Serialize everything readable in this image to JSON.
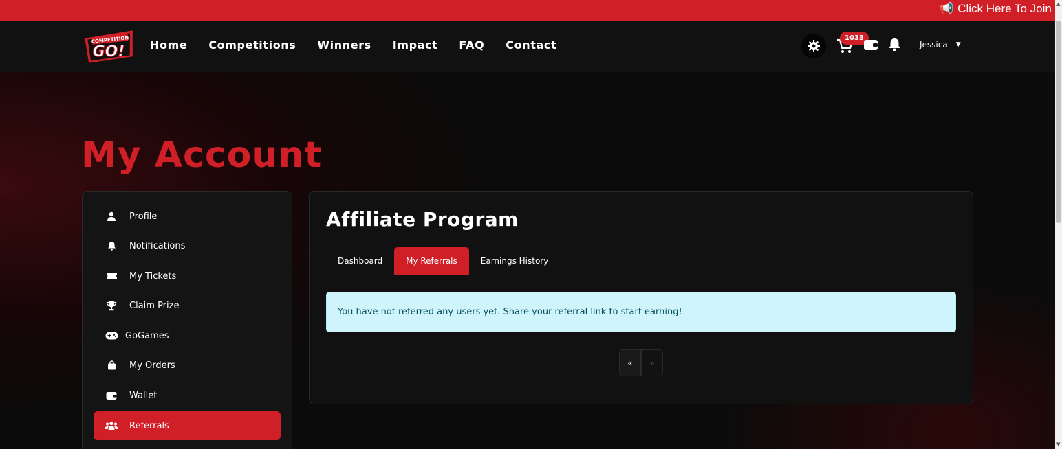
{
  "announcement": {
    "text": "Click Here To Join o"
  },
  "brand": {
    "logo_small": "COMPETITION",
    "logo_big": "GO!"
  },
  "nav": {
    "links": [
      "Home",
      "Competitions",
      "Winners",
      "Impact",
      "FAQ",
      "Contact"
    ],
    "cart_count": "1033",
    "user_name": "Jessica"
  },
  "page": {
    "title": "My Account"
  },
  "sidebar": {
    "items": [
      {
        "label": "Profile",
        "icon": "user-icon"
      },
      {
        "label": "Notifications",
        "icon": "bell-icon"
      },
      {
        "label": "My Tickets",
        "icon": "ticket-icon"
      },
      {
        "label": "Claim Prize",
        "icon": "trophy-icon"
      },
      {
        "label": "GoGames",
        "icon": "gamepad-icon"
      },
      {
        "label": "My Orders",
        "icon": "shopping-bag-icon"
      },
      {
        "label": "Wallet",
        "icon": "wallet-icon"
      },
      {
        "label": "Referrals",
        "icon": "users-icon",
        "active": true
      }
    ]
  },
  "card": {
    "title": "Affiliate Program",
    "tabs": [
      {
        "label": "Dashboard"
      },
      {
        "label": "My Referrals",
        "active": true
      },
      {
        "label": "Earnings History"
      }
    ],
    "alert": "You have not referred any users yet. Share your referral link to start earning!",
    "pager": {
      "prev": "«",
      "next": "»"
    }
  },
  "colors": {
    "accent": "#d11f27",
    "background": "#0b0b0b",
    "card": "#111111",
    "alert_bg": "#cff4fc",
    "alert_text": "#055160"
  }
}
